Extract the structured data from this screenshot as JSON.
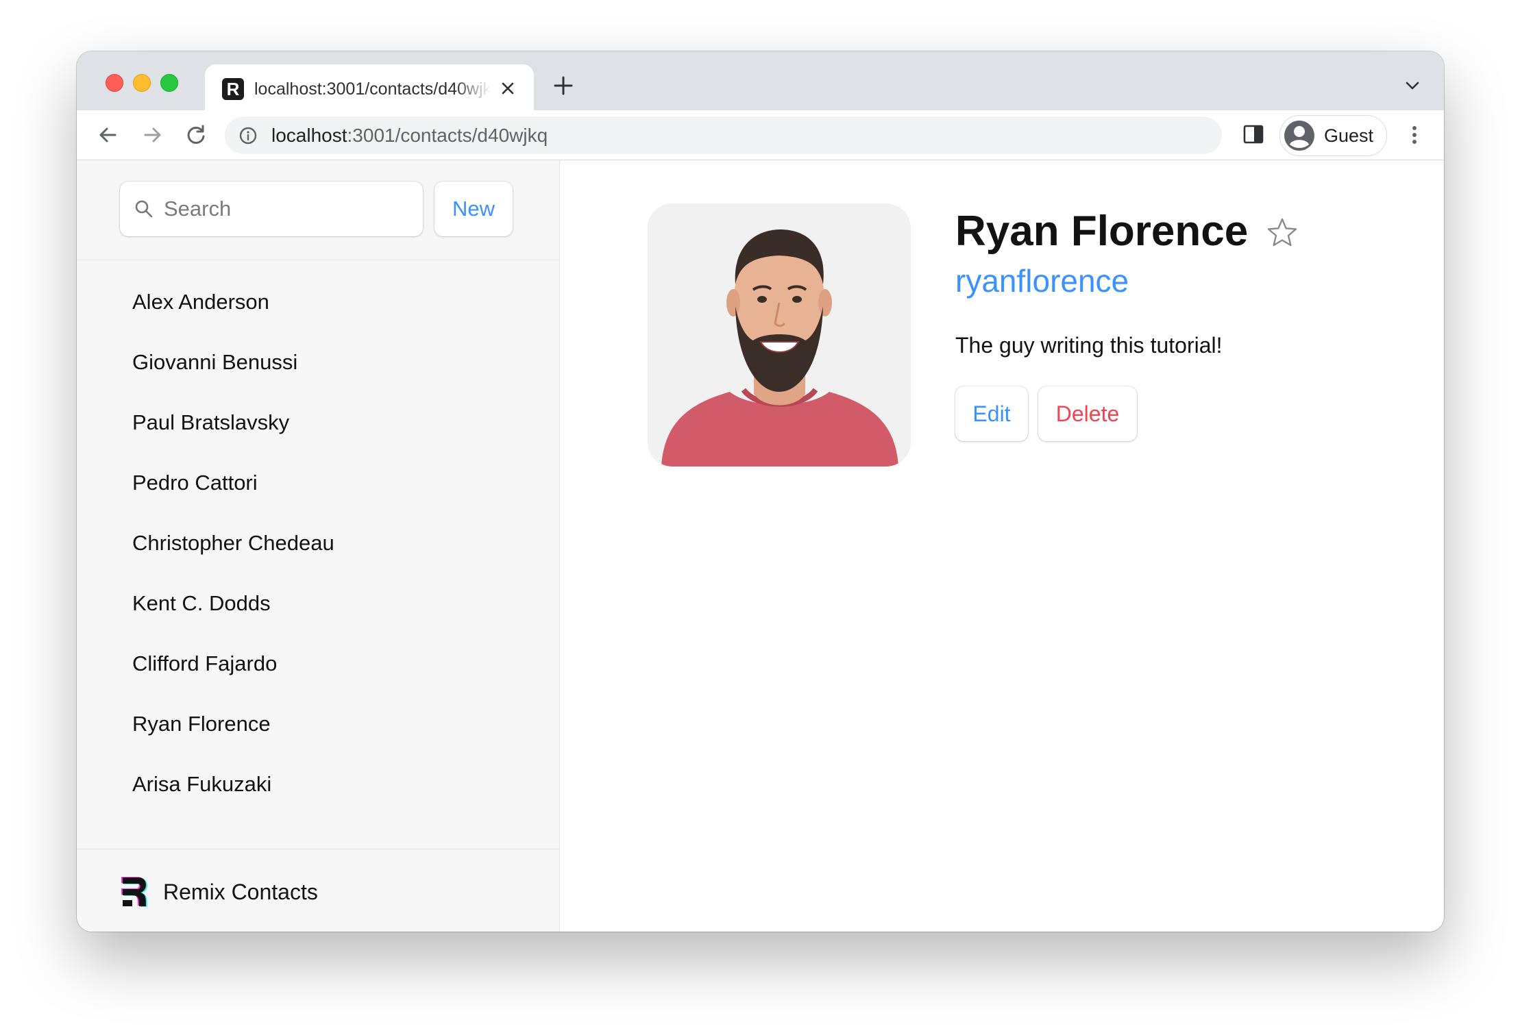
{
  "browser": {
    "tab_title": "localhost:3001/contacts/d40wjkq",
    "url_host": "localhost",
    "url_path": ":3001/contacts/d40wjkq",
    "profile_label": "Guest"
  },
  "sidebar": {
    "search_placeholder": "Search",
    "new_label": "New",
    "contacts": [
      {
        "name": "Alex Anderson"
      },
      {
        "name": "Giovanni Benussi"
      },
      {
        "name": "Paul Bratslavsky"
      },
      {
        "name": "Pedro Cattori"
      },
      {
        "name": "Christopher Chedeau"
      },
      {
        "name": "Kent C. Dodds"
      },
      {
        "name": "Clifford Fajardo"
      },
      {
        "name": "Ryan Florence"
      },
      {
        "name": "Arisa Fukuzaki"
      }
    ],
    "footer_title": "Remix Contacts"
  },
  "contact": {
    "name": "Ryan Florence",
    "twitter": "ryanflorence",
    "notes": "The guy writing this tutorial!",
    "edit_label": "Edit",
    "delete_label": "Delete",
    "favorite": false
  },
  "colors": {
    "accent": "#3992ff",
    "danger": "#f44250"
  }
}
